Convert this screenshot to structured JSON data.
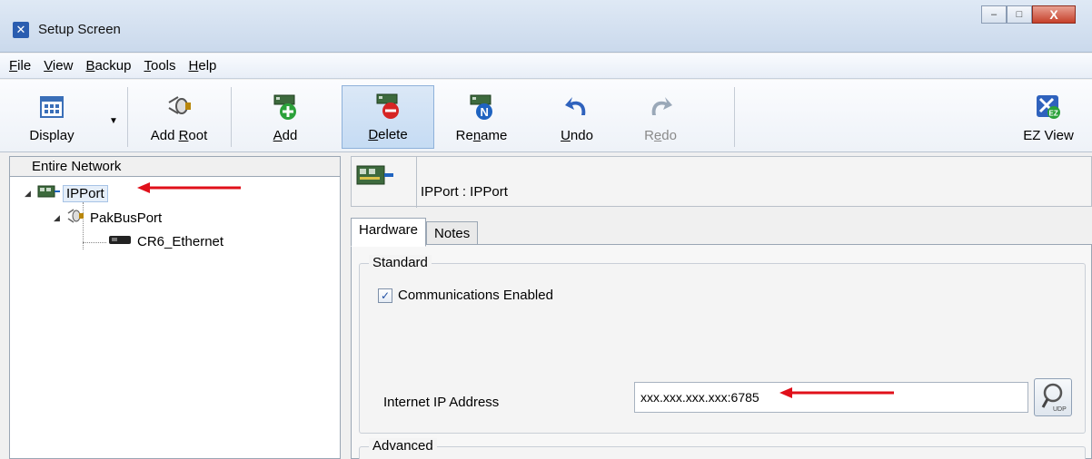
{
  "window": {
    "title": "Setup Screen",
    "controls": {
      "minimize": "–",
      "maximize": "□",
      "close": "X"
    }
  },
  "menu": [
    {
      "label": "File",
      "key": "F",
      "rest": "ile"
    },
    {
      "label": "View",
      "key": "V",
      "rest": "iew"
    },
    {
      "label": "Backup",
      "key": "B",
      "rest": "ackup"
    },
    {
      "label": "Tools",
      "key": "T",
      "rest": "ools"
    },
    {
      "label": "Help",
      "key": "H",
      "rest": "elp"
    }
  ],
  "toolbar": {
    "display": "Display",
    "add_root_pre": "Add ",
    "add_root_key": "R",
    "add_root_post": "oot",
    "add_key": "A",
    "add_post": "dd",
    "delete_key": "D",
    "delete_post": "elete",
    "rename_pre": "Re",
    "rename_key": "n",
    "rename_post": "ame",
    "undo_key": "U",
    "undo_post": "ndo",
    "redo_pre": "R",
    "redo_key": "e",
    "redo_post": "do",
    "ez_view": "EZ View"
  },
  "tree": {
    "header": "Entire Network",
    "nodes": [
      {
        "label": "IPPort",
        "selected": true
      },
      {
        "label": "PakBusPort"
      },
      {
        "label": "CR6_Ethernet"
      }
    ]
  },
  "detail": {
    "title": "IPPort : IPPort",
    "tabs": [
      "Hardware",
      "Notes"
    ],
    "standard_group": "Standard",
    "comm_enabled_label": "Communications Enabled",
    "comm_enabled": true,
    "ip_label": "Internet IP Address",
    "ip_value": "xxx.xxx.xxx.xxx:6785",
    "udp_label": "UDP",
    "advanced_group": "Advanced"
  },
  "colors": {
    "annotation_arrow": "#e0101a",
    "accent": "#2a5db0"
  }
}
